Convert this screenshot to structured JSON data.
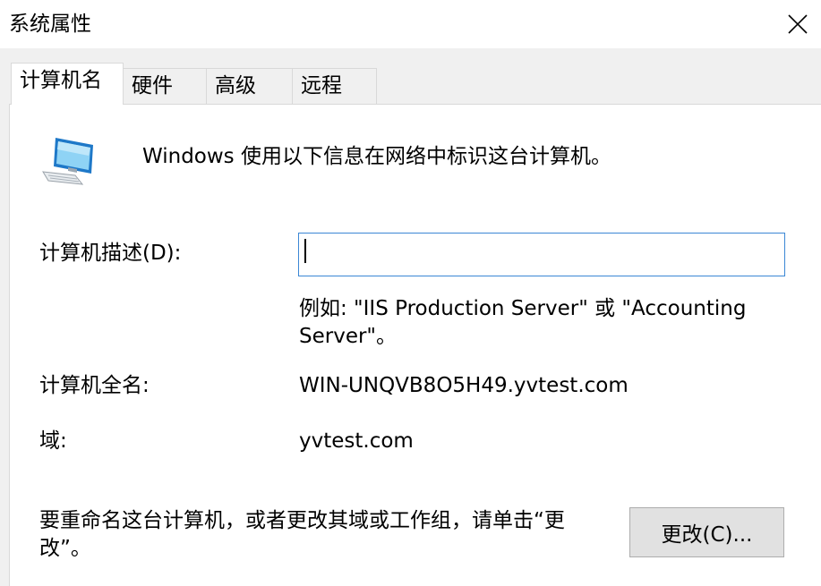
{
  "window": {
    "title": "系统属性"
  },
  "tabs": [
    {
      "label": "计算机名",
      "active": true
    },
    {
      "label": "硬件",
      "active": false
    },
    {
      "label": "高级",
      "active": false
    },
    {
      "label": "远程",
      "active": false
    }
  ],
  "computer_name_tab": {
    "intro_text": "Windows 使用以下信息在网络中标识这台计算机。",
    "description_label": "计算机描述(D):",
    "description_value": "",
    "example_line1": "例如: \"IIS Production Server\" 或 \"Accounting",
    "example_line2": "Server\"。",
    "full_name_label": "计算机全名:",
    "full_name_value": "WIN-UNQVB8O5H49.yvtest.com",
    "domain_label": "域:",
    "domain_value": "yvtest.com",
    "rename_line1": "要重命名这台计算机，或者更改其域或工作组，请单击“更",
    "rename_line2": "改”。",
    "change_button": "更改(C)..."
  },
  "icons": {
    "close": "close-icon",
    "computer": "computer-icon"
  },
  "colors": {
    "input_focus_border": "#3b87d5",
    "client_background": "#f0f0f0",
    "button_background": "#e1e1e1"
  }
}
